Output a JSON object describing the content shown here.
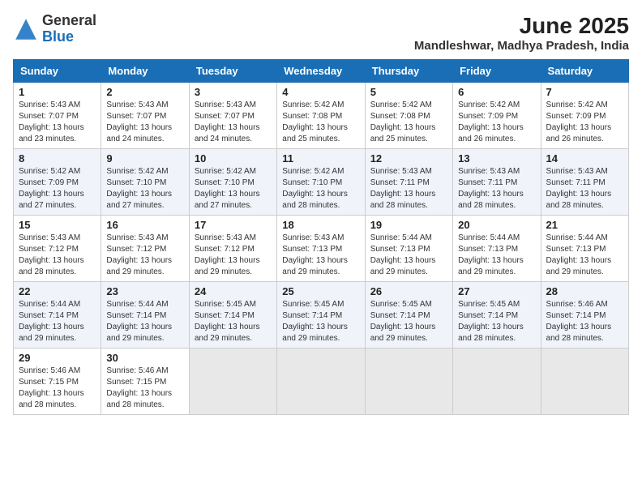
{
  "logo": {
    "general": "General",
    "blue": "Blue"
  },
  "title": {
    "month": "June 2025",
    "location": "Mandleshwar, Madhya Pradesh, India"
  },
  "headers": [
    "Sunday",
    "Monday",
    "Tuesday",
    "Wednesday",
    "Thursday",
    "Friday",
    "Saturday"
  ],
  "weeks": [
    [
      {
        "day": "1",
        "info": "Sunrise: 5:43 AM\nSunset: 7:07 PM\nDaylight: 13 hours\nand 23 minutes."
      },
      {
        "day": "2",
        "info": "Sunrise: 5:43 AM\nSunset: 7:07 PM\nDaylight: 13 hours\nand 24 minutes."
      },
      {
        "day": "3",
        "info": "Sunrise: 5:43 AM\nSunset: 7:07 PM\nDaylight: 13 hours\nand 24 minutes."
      },
      {
        "day": "4",
        "info": "Sunrise: 5:42 AM\nSunset: 7:08 PM\nDaylight: 13 hours\nand 25 minutes."
      },
      {
        "day": "5",
        "info": "Sunrise: 5:42 AM\nSunset: 7:08 PM\nDaylight: 13 hours\nand 25 minutes."
      },
      {
        "day": "6",
        "info": "Sunrise: 5:42 AM\nSunset: 7:09 PM\nDaylight: 13 hours\nand 26 minutes."
      },
      {
        "day": "7",
        "info": "Sunrise: 5:42 AM\nSunset: 7:09 PM\nDaylight: 13 hours\nand 26 minutes."
      }
    ],
    [
      {
        "day": "8",
        "info": "Sunrise: 5:42 AM\nSunset: 7:09 PM\nDaylight: 13 hours\nand 27 minutes."
      },
      {
        "day": "9",
        "info": "Sunrise: 5:42 AM\nSunset: 7:10 PM\nDaylight: 13 hours\nand 27 minutes."
      },
      {
        "day": "10",
        "info": "Sunrise: 5:42 AM\nSunset: 7:10 PM\nDaylight: 13 hours\nand 27 minutes."
      },
      {
        "day": "11",
        "info": "Sunrise: 5:42 AM\nSunset: 7:10 PM\nDaylight: 13 hours\nand 28 minutes."
      },
      {
        "day": "12",
        "info": "Sunrise: 5:43 AM\nSunset: 7:11 PM\nDaylight: 13 hours\nand 28 minutes."
      },
      {
        "day": "13",
        "info": "Sunrise: 5:43 AM\nSunset: 7:11 PM\nDaylight: 13 hours\nand 28 minutes."
      },
      {
        "day": "14",
        "info": "Sunrise: 5:43 AM\nSunset: 7:11 PM\nDaylight: 13 hours\nand 28 minutes."
      }
    ],
    [
      {
        "day": "15",
        "info": "Sunrise: 5:43 AM\nSunset: 7:12 PM\nDaylight: 13 hours\nand 28 minutes."
      },
      {
        "day": "16",
        "info": "Sunrise: 5:43 AM\nSunset: 7:12 PM\nDaylight: 13 hours\nand 29 minutes."
      },
      {
        "day": "17",
        "info": "Sunrise: 5:43 AM\nSunset: 7:12 PM\nDaylight: 13 hours\nand 29 minutes."
      },
      {
        "day": "18",
        "info": "Sunrise: 5:43 AM\nSunset: 7:13 PM\nDaylight: 13 hours\nand 29 minutes."
      },
      {
        "day": "19",
        "info": "Sunrise: 5:44 AM\nSunset: 7:13 PM\nDaylight: 13 hours\nand 29 minutes."
      },
      {
        "day": "20",
        "info": "Sunrise: 5:44 AM\nSunset: 7:13 PM\nDaylight: 13 hours\nand 29 minutes."
      },
      {
        "day": "21",
        "info": "Sunrise: 5:44 AM\nSunset: 7:13 PM\nDaylight: 13 hours\nand 29 minutes."
      }
    ],
    [
      {
        "day": "22",
        "info": "Sunrise: 5:44 AM\nSunset: 7:14 PM\nDaylight: 13 hours\nand 29 minutes."
      },
      {
        "day": "23",
        "info": "Sunrise: 5:44 AM\nSunset: 7:14 PM\nDaylight: 13 hours\nand 29 minutes."
      },
      {
        "day": "24",
        "info": "Sunrise: 5:45 AM\nSunset: 7:14 PM\nDaylight: 13 hours\nand 29 minutes."
      },
      {
        "day": "25",
        "info": "Sunrise: 5:45 AM\nSunset: 7:14 PM\nDaylight: 13 hours\nand 29 minutes."
      },
      {
        "day": "26",
        "info": "Sunrise: 5:45 AM\nSunset: 7:14 PM\nDaylight: 13 hours\nand 29 minutes."
      },
      {
        "day": "27",
        "info": "Sunrise: 5:45 AM\nSunset: 7:14 PM\nDaylight: 13 hours\nand 28 minutes."
      },
      {
        "day": "28",
        "info": "Sunrise: 5:46 AM\nSunset: 7:14 PM\nDaylight: 13 hours\nand 28 minutes."
      }
    ],
    [
      {
        "day": "29",
        "info": "Sunrise: 5:46 AM\nSunset: 7:15 PM\nDaylight: 13 hours\nand 28 minutes."
      },
      {
        "day": "30",
        "info": "Sunrise: 5:46 AM\nSunset: 7:15 PM\nDaylight: 13 hours\nand 28 minutes."
      },
      {
        "day": "",
        "info": ""
      },
      {
        "day": "",
        "info": ""
      },
      {
        "day": "",
        "info": ""
      },
      {
        "day": "",
        "info": ""
      },
      {
        "day": "",
        "info": ""
      }
    ]
  ]
}
